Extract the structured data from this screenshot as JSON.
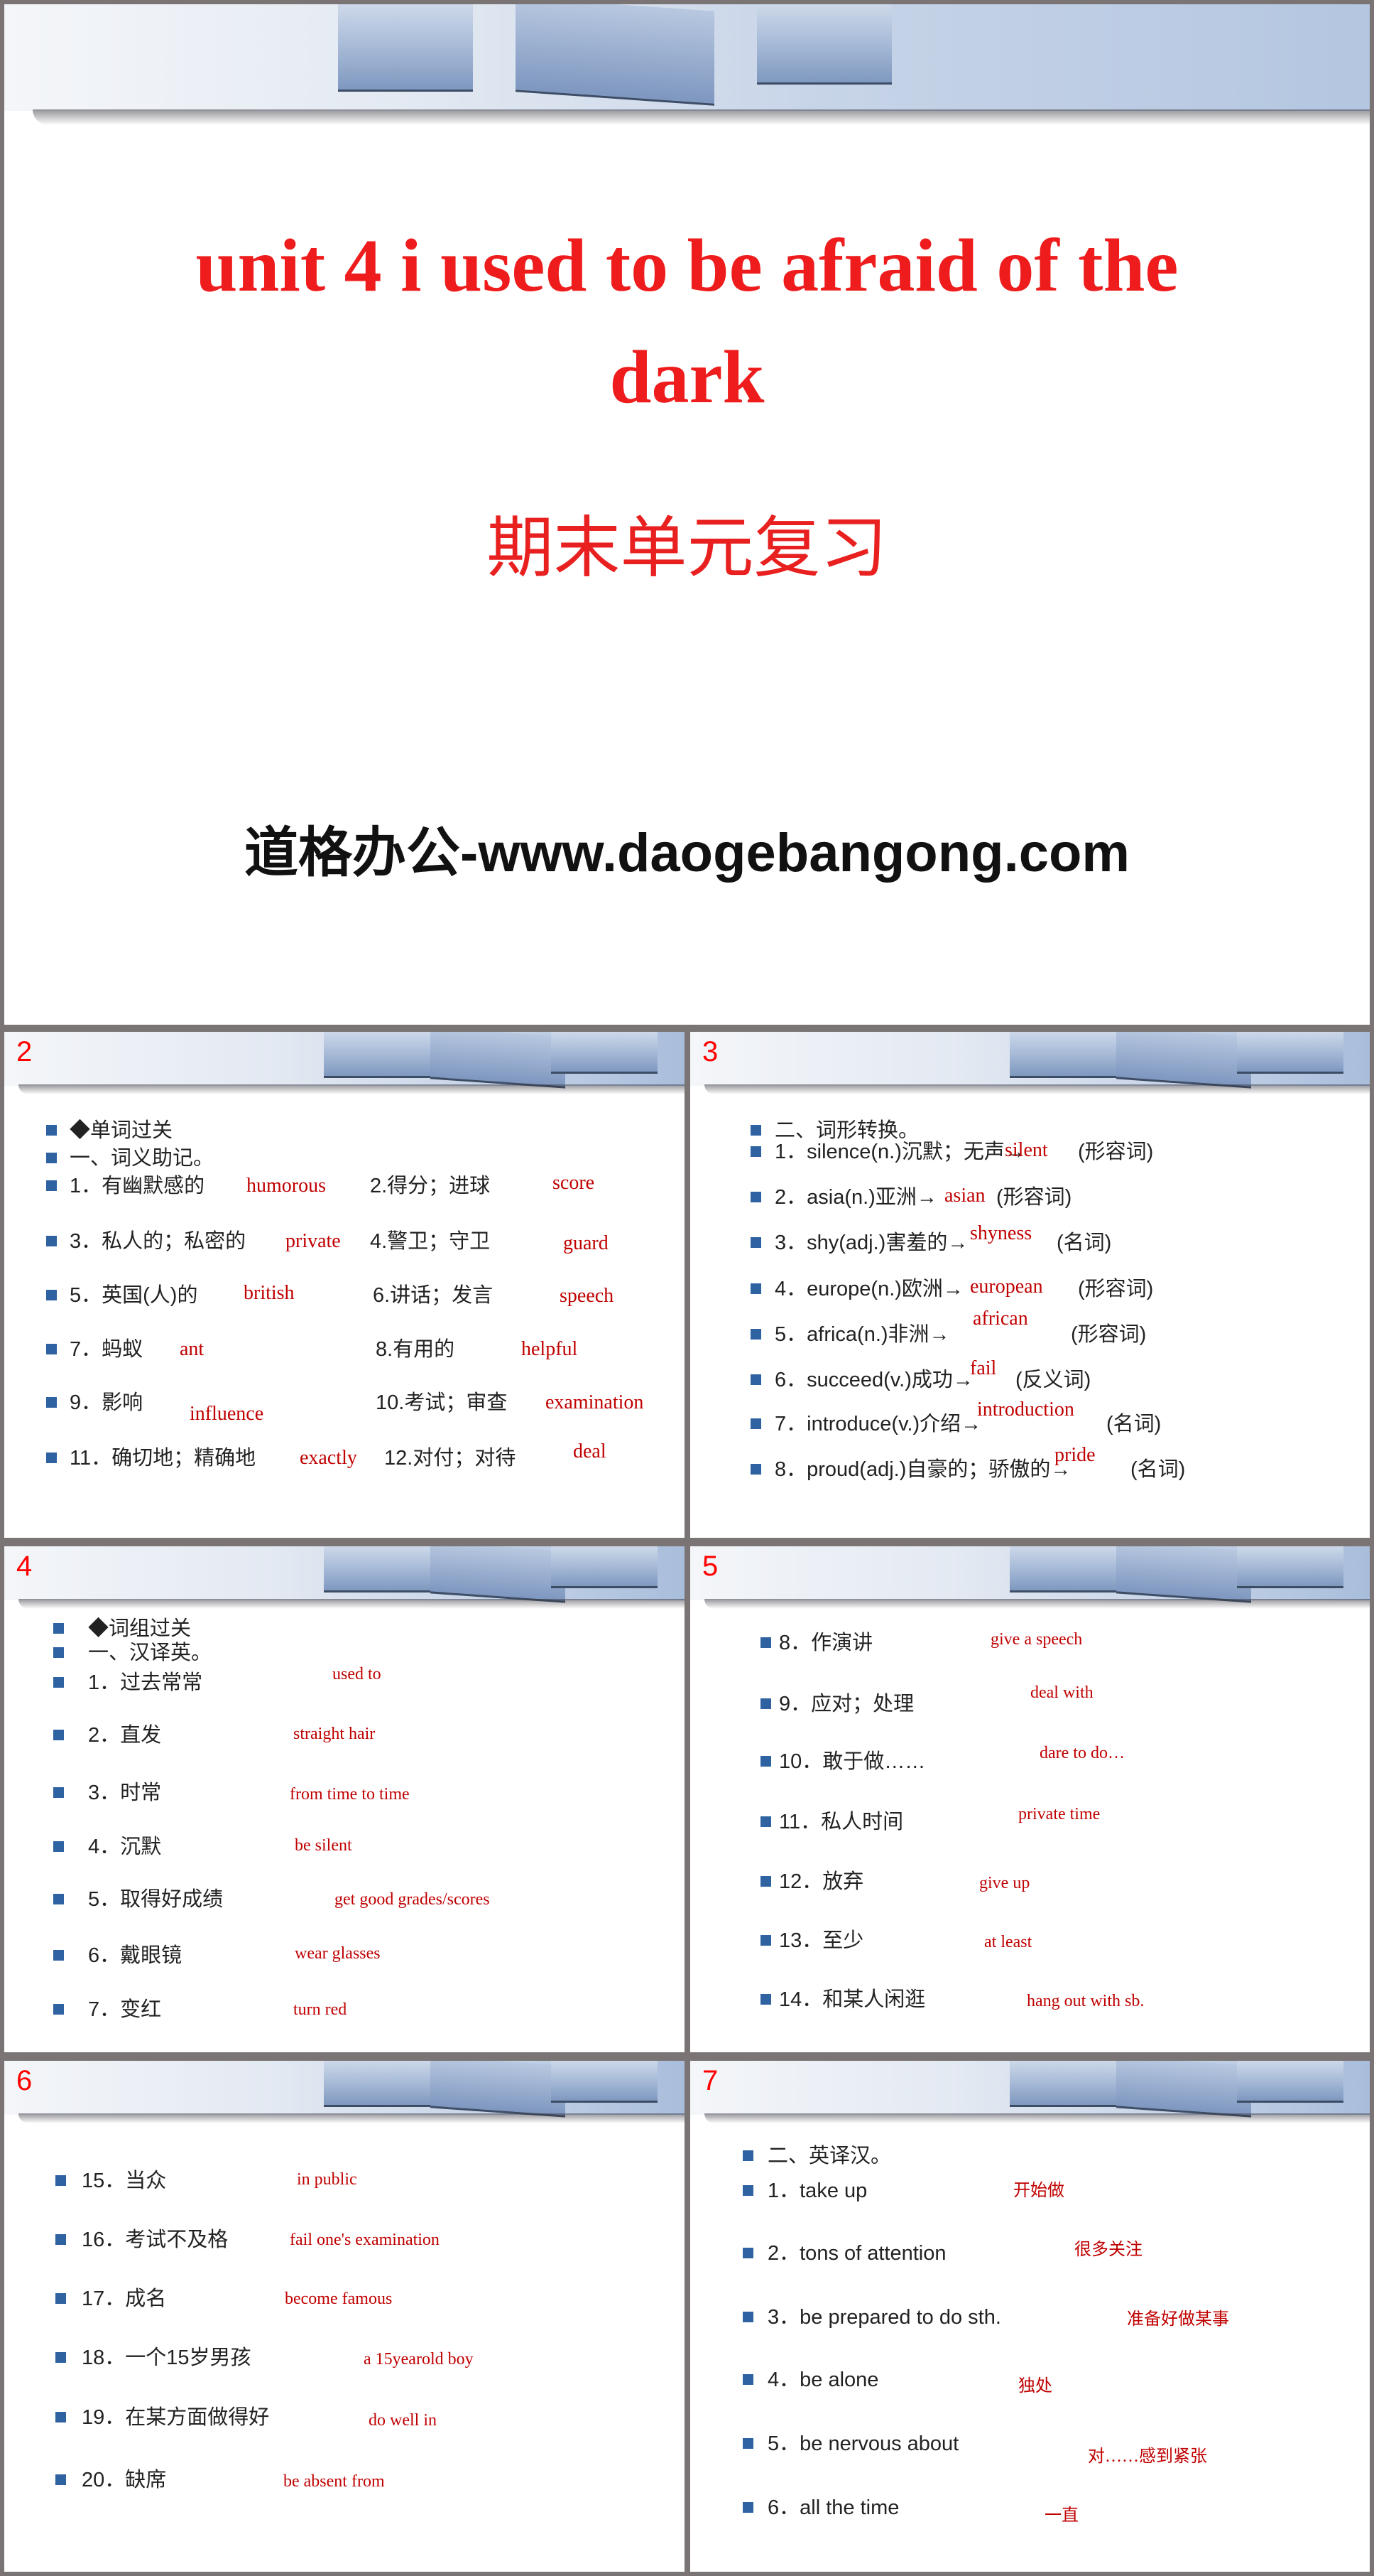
{
  "title_slide": {
    "title_line1": "unit 4  i used to be afraid of the",
    "title_line2": "dark",
    "subtitle": "期末单元复习",
    "watermark": "道格办公-www.daogebangong.com"
  },
  "colors": {
    "answer": "#c00000",
    "slide_number": "#ff0000",
    "bullet": "#2e62a0",
    "title": "#ee1c1c"
  },
  "slides": [
    {
      "number": "2",
      "lines": [
        {
          "q": "◆单词过关"
        },
        {
          "q": "一、词义助记。"
        },
        {
          "q": "1．有幽默感的",
          "a": "humorous",
          "q2": "2.得分；进球",
          "a2": "score"
        },
        {
          "q": "3．私人的；私密的",
          "a": "private",
          "q2": "4.警卫；守卫",
          "a2": "guard"
        },
        {
          "q": "5．英国(人)的",
          "a": "british",
          "q2": "6.讲话；发言",
          "a2": "speech"
        },
        {
          "q": "7．蚂蚁",
          "a": "ant",
          "q2": "8.有用的",
          "a2": "helpful"
        },
        {
          "q": "9．影响",
          "a": "influence",
          "q2": "10.考试；审查",
          "a2": "examination"
        },
        {
          "q": "11．确切地；精确地",
          "a": "exactly",
          "q2": "12.对付；对待",
          "a2": "deal"
        }
      ]
    },
    {
      "number": "3",
      "lines": [
        {
          "q": "二、词形转换。"
        },
        {
          "q": "1．silence(n.)沉默；无声→",
          "a": "silent",
          "note": "(形容词)"
        },
        {
          "q": "2．asia(n.)亚洲→",
          "a": "asian",
          "note": "(形容词)"
        },
        {
          "q": "3．shy(adj.)害羞的→",
          "a": "shyness",
          "note": "(名词)"
        },
        {
          "q": "4．europe(n.)欧洲→",
          "a": "european",
          "note": "(形容词)"
        },
        {
          "q": "5．africa(n.)非洲→",
          "a": "african",
          "note": "(形容词)"
        },
        {
          "q": "6．succeed(v.)成功→",
          "a": "fail",
          "note": "(反义词)"
        },
        {
          "q": "7．introduce(v.)介绍→",
          "a": "introduction",
          "note": "(名词)"
        },
        {
          "q": "8．proud(adj.)自豪的；骄傲的→",
          "a": "pride",
          "note": "(名词)"
        }
      ]
    },
    {
      "number": "4",
      "lines": [
        {
          "q": "◆词组过关"
        },
        {
          "q": "一、汉译英。"
        },
        {
          "q": "1．过去常常",
          "a": "used to"
        },
        {
          "q": "2．直发",
          "a": "straight hair"
        },
        {
          "q": "3．时常",
          "a": "from time to time"
        },
        {
          "q": "4．沉默",
          "a": "be silent"
        },
        {
          "q": "5．取得好成绩",
          "a": "get good grades/scores"
        },
        {
          "q": "6．戴眼镜",
          "a": "wear glasses"
        },
        {
          "q": "7．变红",
          "a": "turn red"
        }
      ]
    },
    {
      "number": "5",
      "lines": [
        {
          "q": "8．作演讲",
          "a": "give a speech"
        },
        {
          "q": "9．应对；处理",
          "a": "deal with"
        },
        {
          "q": "10．敢于做……",
          "a": "dare to do…"
        },
        {
          "q": "11．私人时间",
          "a": "private time"
        },
        {
          "q": "12．放弃",
          "a": "give up"
        },
        {
          "q": "13．至少",
          "a": "at least"
        },
        {
          "q": "14．和某人闲逛",
          "a": "hang out with sb."
        }
      ]
    },
    {
      "number": "6",
      "lines": [
        {
          "q": "15．当众",
          "a": "in public"
        },
        {
          "q": "16．考试不及格",
          "a": "fail one's examination"
        },
        {
          "q": "17．成名",
          "a": "become famous"
        },
        {
          "q": "18．一个15岁男孩",
          "a": "a 15yearold boy"
        },
        {
          "q": "19．在某方面做得好",
          "a": "do well in"
        },
        {
          "q": "20．缺席",
          "a": "be absent from"
        }
      ]
    },
    {
      "number": "7",
      "lines": [
        {
          "q": "二、英译汉。"
        },
        {
          "q": "1．take up",
          "a": "开始做"
        },
        {
          "q": "2．tons of attention",
          "a": "很多关注"
        },
        {
          "q": "3．be prepared to do sth.",
          "a": "准备好做某事"
        },
        {
          "q": "4．be alone",
          "a": "独处"
        },
        {
          "q": "5．be nervous about",
          "a": "对……感到紧张"
        },
        {
          "q": "6．all the time",
          "a": "一直"
        }
      ]
    }
  ]
}
